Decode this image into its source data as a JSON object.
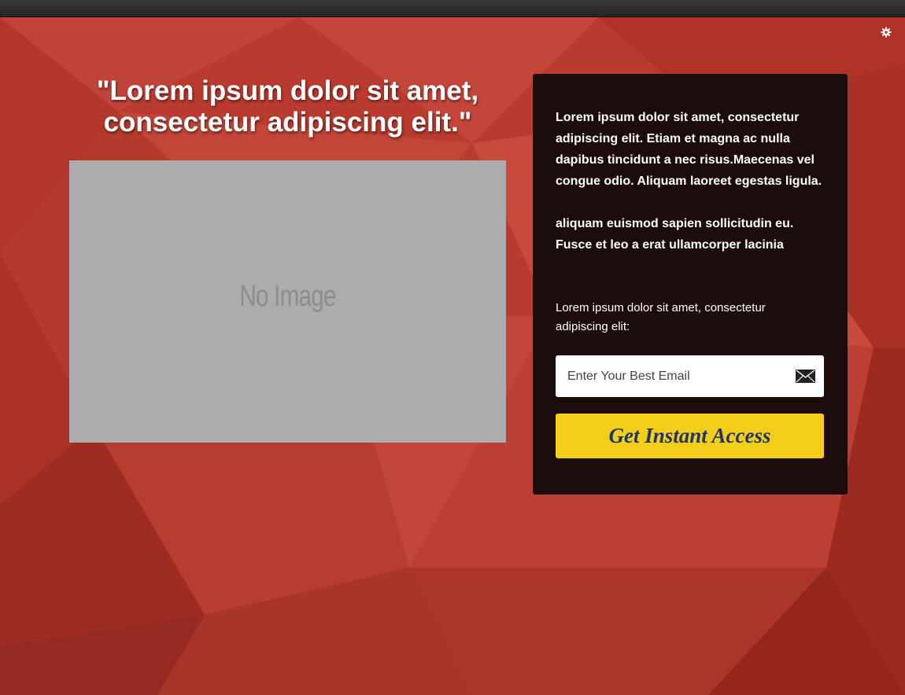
{
  "headline": "\"Lorem ipsum dolor sit amet, consectetur adipiscing elit.\"",
  "image_placeholder": "No Image",
  "panel": {
    "paragraph1": "Lorem ipsum dolor sit amet, consectetur adipiscing elit. Etiam et magna ac nulla dapibus tincidunt a nec risus.Maecenas vel congue odio. Aliquam laoreet egestas ligula.",
    "paragraph2": "aliquam euismod sapien sollicitudin eu. Fusce et leo a erat ullamcorper lacinia",
    "prompt": "Lorem ipsum dolor sit amet, consectetur adipiscing elit:",
    "email_placeholder": "Enter Your Best Email",
    "email_value": "",
    "cta_label": "Get Instant Access"
  },
  "icons": {
    "settings": "gear-icon",
    "email": "envelope-icon"
  },
  "colors": {
    "background": "#b83a2e",
    "panel": "#1c0c0b",
    "cta": "#f5cd1b",
    "cta_text": "#1e3565",
    "image_placeholder": "#acacac"
  }
}
